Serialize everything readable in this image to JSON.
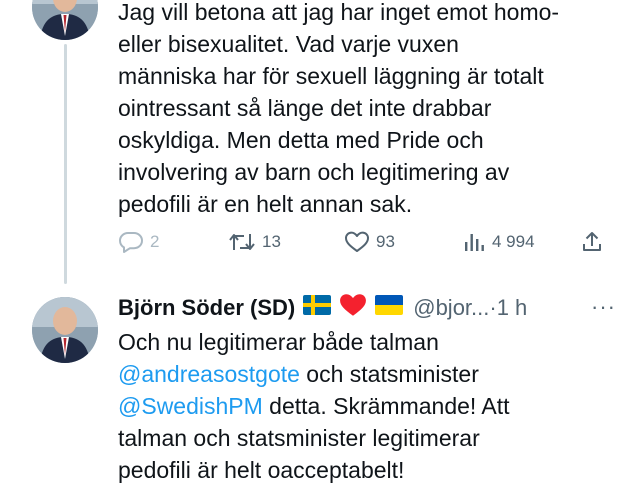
{
  "tweet1": {
    "lines": [
      "Jag vill betona att jag har inget emot homo-",
      "eller bisexualitet. Vad varje vuxen",
      "människa har för sexuell läggning är totalt",
      "ointressant så länge det inte drabbar",
      "oskyldiga. Men detta med Pride och",
      "involvering av barn och legitimering av",
      "pedofili är en helt annan sak."
    ],
    "actions": {
      "replies": "2",
      "retweets": "13",
      "likes": "93",
      "views": "4 994"
    }
  },
  "tweet2": {
    "name": "Björn Söder (SD)",
    "handle": "@bjor...",
    "separator": "·",
    "time": "1 h",
    "more": "···",
    "line1": "Och nu legitimerar både talman",
    "mention1": "@andreasostgote",
    "line2_rest": " och statsminister",
    "mention2": "@SwedishPM",
    "line3_rest": " detta. Skrämmande! Att",
    "line4": "talman och statsminister legitimerar",
    "line5": "pedofili är helt oacceptabelt!"
  },
  "colors": {
    "text": "#0f1419",
    "secondary": "#536471",
    "link": "#1d9bf0",
    "thread_line": "#cfd9de",
    "like_heart": "#f4212e"
  },
  "icons": [
    "reply-icon",
    "retweet-icon",
    "like-icon",
    "views-icon",
    "share-icon",
    "sweden-flag-icon",
    "heart-emoji-icon",
    "ukraine-flag-icon",
    "more-icon"
  ]
}
